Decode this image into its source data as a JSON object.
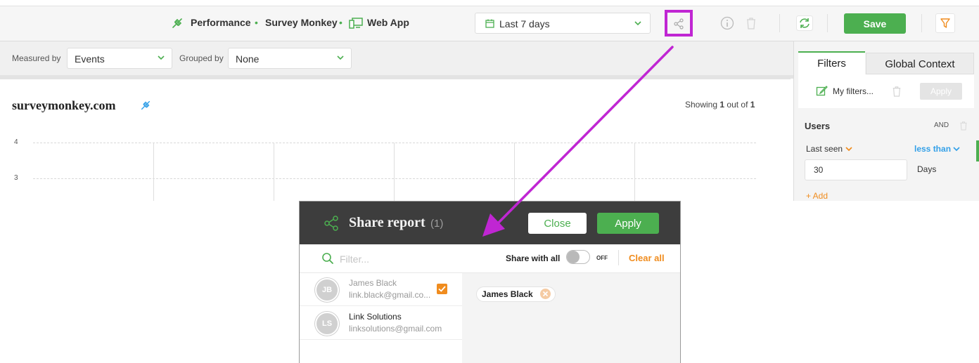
{
  "breadcrumb": {
    "project": "Performance",
    "account": "Survey Monkey",
    "app": "Web App"
  },
  "header": {
    "date_range": "Last 7 days",
    "save_label": "Save"
  },
  "controls": {
    "measured_label": "Measured by",
    "measured_value": "Events",
    "grouped_label": "Grouped by",
    "grouped_value": "None"
  },
  "report": {
    "title": "surveymonkey.com",
    "showing_prefix": "Showing",
    "showing_current": "1",
    "showing_mid": "out of",
    "showing_total": "1",
    "y_ticks": [
      "4",
      "3"
    ]
  },
  "filters_panel": {
    "tabs": [
      "Filters",
      "Global Context"
    ],
    "my_filters_label": "My filters...",
    "apply_label": "Apply",
    "group_title": "Users",
    "logic": "AND",
    "condition_field": "Last seen",
    "condition_operator": "less than",
    "condition_value": "30",
    "condition_unit": "Days",
    "add_label": "+ Add"
  },
  "share_modal": {
    "title": "Share report",
    "count": "(1)",
    "close_label": "Close",
    "apply_label": "Apply",
    "filter_placeholder": "Filter...",
    "share_with_all_label": "Share with all",
    "toggle_state": "OFF",
    "clear_all_label": "Clear all",
    "users": [
      {
        "initials": "JB",
        "name": "James Black",
        "email": "link.black@gmail.co...",
        "selected": true
      },
      {
        "initials": "LS",
        "name": "Link Solutions",
        "email": "linksolutions@gmail.com",
        "selected": false
      }
    ],
    "selected_chips": [
      "James Black"
    ]
  },
  "colors": {
    "accent_green": "#4caf50",
    "accent_orange": "#f08c1e",
    "link_blue": "#33a0e8",
    "highlight_magenta": "#c026d3",
    "modal_header": "#3d3d3d"
  }
}
